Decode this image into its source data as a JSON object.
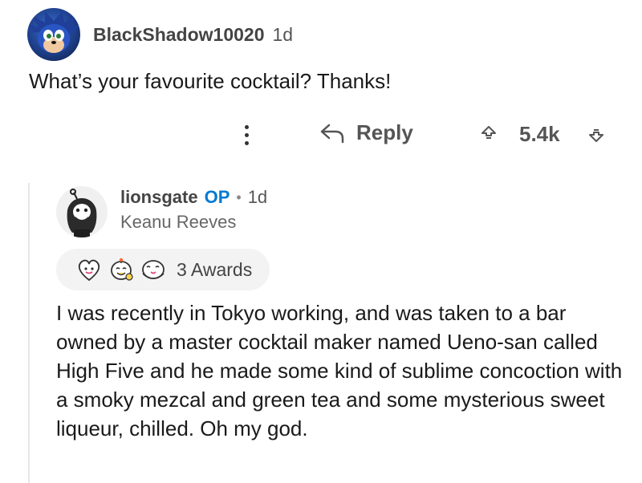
{
  "comment": {
    "username": "BlackShadow10020",
    "age": "1d",
    "text": "What’s your favourite cocktail? Thanks!",
    "actions": {
      "reply_label": "Reply",
      "score": "5.4k"
    }
  },
  "reply": {
    "username": "lionsgate",
    "op_label": "OP",
    "separator": "•",
    "age": "1d",
    "flair": "Keanu Reeves",
    "awards_label": "3 Awards",
    "body": "I was recently in Tokyo working, and was taken to a bar owned by a master cocktail maker named Ueno-san called High Five and he made some kind of sublime concoction with a smoky mezcal and green tea and some mysterious sweet liqueur, chilled. Oh my god."
  },
  "colors": {
    "op_blue": "#0079d3",
    "text": "#1a1a1b",
    "muted": "#555555"
  },
  "icons": [
    "avatar-sonic",
    "more-vertical-icon",
    "reply-arrow-icon",
    "upvote-icon",
    "downvote-icon",
    "avatar-keanu",
    "heart-award-icon",
    "wholesome-award-icon",
    "hugz-award-icon"
  ]
}
